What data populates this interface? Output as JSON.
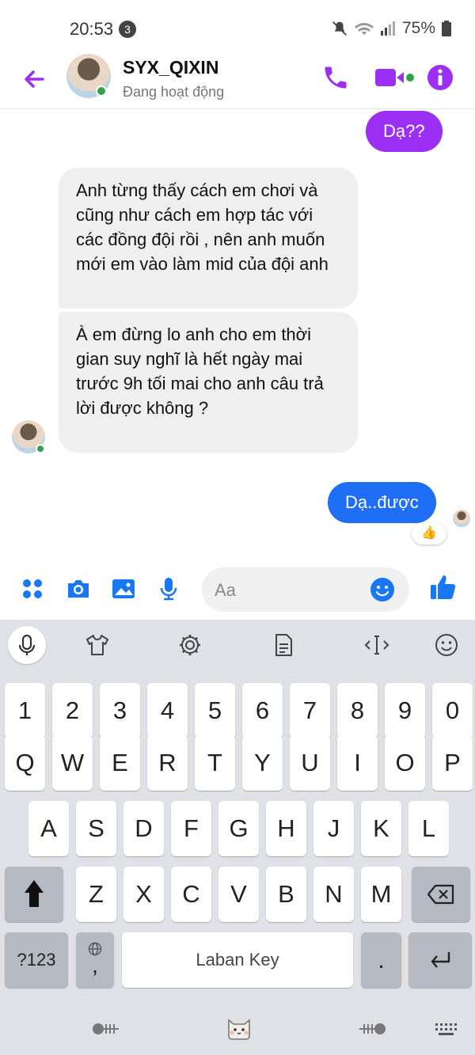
{
  "status_bar": {
    "time": "20:53",
    "notification_count": "3",
    "battery": "75%"
  },
  "header": {
    "contact_name": "SYX_QIXIN",
    "presence": "Đang hoạt động"
  },
  "messages": [
    {
      "direction": "outgoing",
      "text": "Dạ??",
      "color": "#9b2ff3"
    },
    {
      "direction": "incoming",
      "text": "Anh từng thấy cách em chơi và cũng như cách em hợp tác với các đồng đội rồi , nên anh muốn mới em vào làm mid của đội anh"
    },
    {
      "direction": "incoming",
      "text": "À em đừng lo anh cho em thời gian suy nghĩ là hết ngày mai trước 9h tối mai cho anh câu trả lời được không ?"
    },
    {
      "direction": "outgoing",
      "text": "Dạ..được",
      "color": "#1e6ff5",
      "reaction": "👍"
    }
  ],
  "composer": {
    "placeholder": "Aa"
  },
  "keyboard": {
    "number_row": [
      "1",
      "2",
      "3",
      "4",
      "5",
      "6",
      "7",
      "8",
      "9",
      "0"
    ],
    "row1": [
      "Q",
      "W",
      "E",
      "R",
      "T",
      "Y",
      "U",
      "I",
      "O",
      "P"
    ],
    "row2": [
      "A",
      "S",
      "D",
      "F",
      "G",
      "H",
      "J",
      "K",
      "L"
    ],
    "row3": [
      "Z",
      "X",
      "C",
      "V",
      "B",
      "N",
      "M"
    ],
    "symbols_key": "?123",
    "comma_key": ",",
    "space_label": "Laban Key",
    "period_key": "."
  },
  "colors": {
    "accent": "#9b2ff3",
    "blue": "#1e6ff5",
    "messenger_blue": "#1877f2"
  }
}
